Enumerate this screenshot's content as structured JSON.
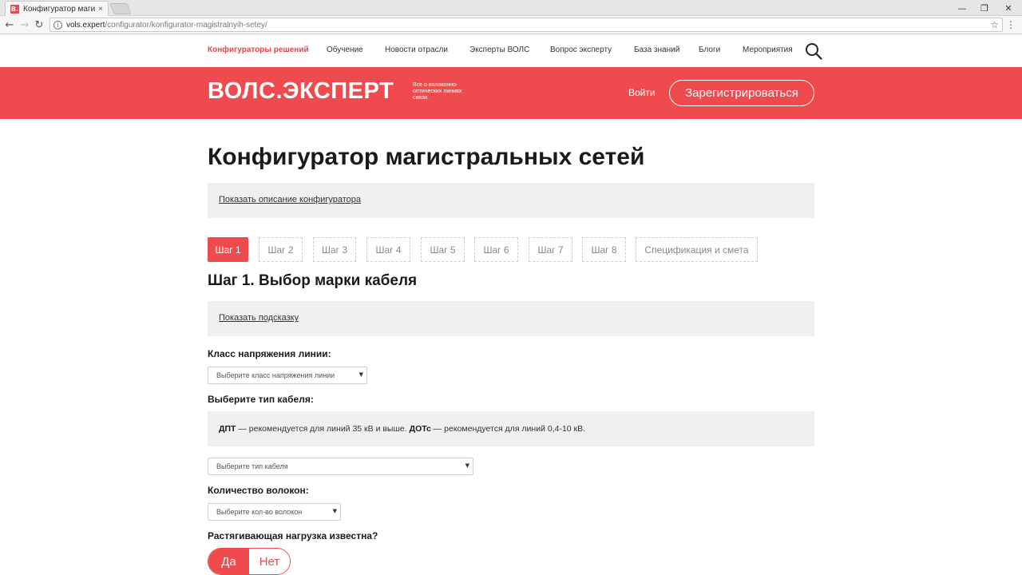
{
  "browser": {
    "tab_title": "Конфигуратор магистра",
    "tab_close": "×",
    "favicon": "B.",
    "url_host": "vols.expert",
    "url_path": "/configurator/konfigurator-magistralnyih-setey/",
    "window_controls": [
      "—",
      "❐",
      "✕"
    ]
  },
  "topnav": {
    "items": [
      "Конфигураторы решений",
      "Обучение",
      "Новости отрасли",
      "Эксперты ВОЛС",
      "Вопрос эксперту",
      "База знаний",
      "Блоги",
      "Мероприятия"
    ],
    "active_index": 0
  },
  "brand": {
    "logo": "ВОЛС.ЭКСПЕРТ",
    "tagline": "Все о волоконно-оптических линиях связи.",
    "login": "Войти",
    "register": "Зарегистрироваться",
    "color": "#ef4a4d"
  },
  "main": {
    "title": "Конфигуратор магистральных сетей",
    "show_description": "Показать описание конфигуратора",
    "steps": [
      "Шаг 1",
      "Шаг 2",
      "Шаг 3",
      "Шаг 4",
      "Шаг 5",
      "Шаг 6",
      "Шаг 7",
      "Шаг 8",
      "Спецификация и смета"
    ],
    "active_step": 0,
    "step_heading": "Шаг 1. Выбор марки кабеля",
    "show_hint": "Показать подсказку",
    "voltage_label": "Класс напряжения линии:",
    "voltage_placeholder": "Выберите класс напряжения линии",
    "cable_type_label": "Выберите тип кабеля:",
    "cable_info": {
      "dpt": "ДПТ",
      "dpt_text": " — рекомендуется для линий 35 кВ и выше. ",
      "dotc": "ДОТс",
      "dotc_text": " — рекомендуется для линий 0,4-10 кВ."
    },
    "cable_type_placeholder": "Выберите тип кабеля",
    "fibers_label": "Количество волокон:",
    "fibers_placeholder": "Выберите кол-во волокон",
    "load_label": "Растягивающая нагрузка известна?",
    "yes": "Да",
    "no": "Нет",
    "load_selected": "Да"
  }
}
